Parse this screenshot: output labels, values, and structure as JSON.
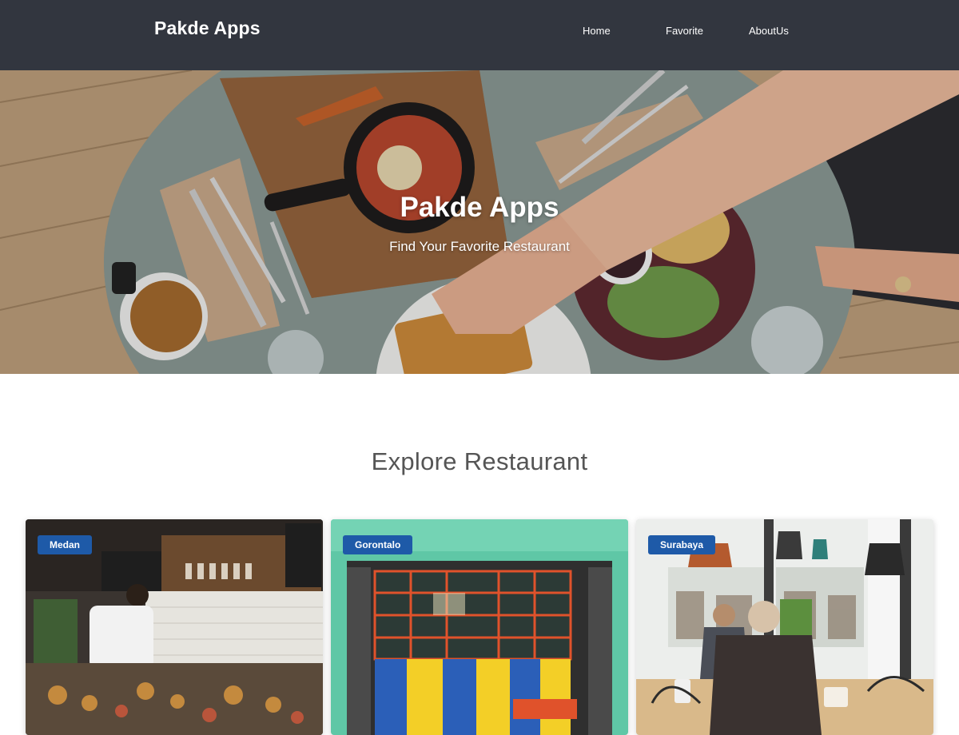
{
  "header": {
    "brand": "Pakde Apps",
    "nav": [
      {
        "label": "Home"
      },
      {
        "label": "Favorite"
      },
      {
        "label": "AboutUs"
      }
    ]
  },
  "hero": {
    "title": "Pakde Apps",
    "subtitle": "Find Your Favorite Restaurant"
  },
  "explore": {
    "title": "Explore Restaurant",
    "cards": [
      {
        "city": "Medan",
        "image": "restaurant-kitchen-photo"
      },
      {
        "city": "Gorontalo",
        "image": "restaurant-storefront-photo"
      },
      {
        "city": "Surabaya",
        "image": "cafe-interior-photo"
      }
    ]
  },
  "colors": {
    "header_bg": "#32363f",
    "badge_bg": "#1e5aa8",
    "title_text": "#555555"
  }
}
